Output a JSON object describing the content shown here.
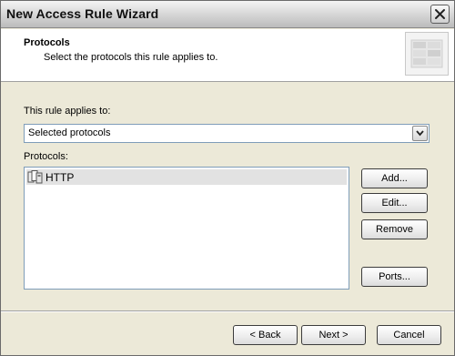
{
  "window": {
    "title": "New Access Rule Wizard"
  },
  "header": {
    "title": "Protocols",
    "subtitle": "Select the protocols this rule applies to."
  },
  "applies_to": {
    "label": "This rule applies to:",
    "selected": "Selected protocols"
  },
  "protocols": {
    "label": "Protocols:",
    "items": [
      {
        "label": "HTTP",
        "icon": "protocol-icon"
      }
    ]
  },
  "side_buttons": {
    "add": "Add...",
    "edit": "Edit...",
    "remove": "Remove",
    "ports": "Ports..."
  },
  "footer": {
    "back": "< Back",
    "next": "Next >",
    "cancel": "Cancel"
  },
  "colors": {
    "dialog_bg": "#ece9d8",
    "field_border": "#7f9db9",
    "selected_item_bg": "#e2e2e2"
  }
}
